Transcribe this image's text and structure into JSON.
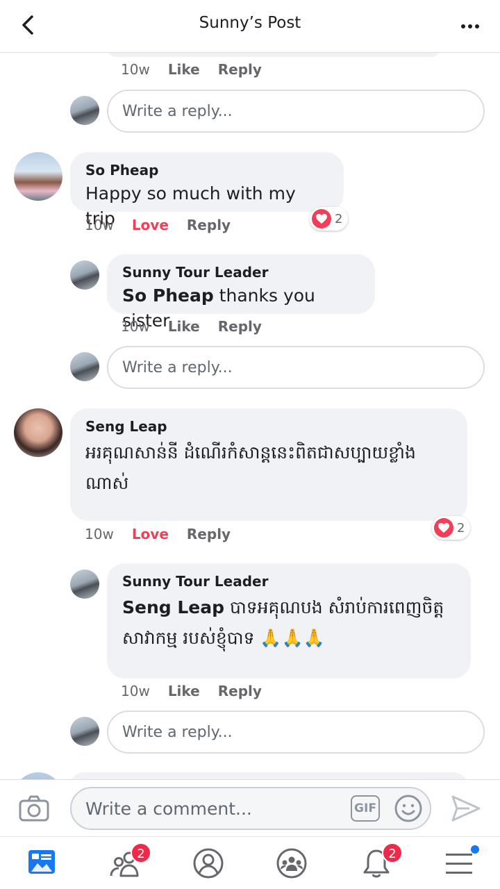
{
  "header": {
    "title": "Sunny’s Post"
  },
  "thread": {
    "top_meta": {
      "time": "10w",
      "like": "Like",
      "reply": "Reply"
    },
    "reply_placeholder": "Write a reply...",
    "comments": [
      {
        "author": "So Pheap",
        "text": "Happy so much with my trip",
        "time": "10w",
        "action": "Love",
        "reply": "Reply",
        "reaction_count": "2",
        "replies": [
          {
            "author": "Sunny Tour Leader",
            "mention": "So Pheap",
            "text": " thanks you sister",
            "time": "10w",
            "like": "Like",
            "reply": "Reply"
          }
        ]
      },
      {
        "author": "Seng Leap",
        "text": "អរគុណសាន់នី ដំណើរកំសាន្តនេះពិតជាសប្បាយខ្លាំងណាស់",
        "time": "10w",
        "action": "Love",
        "reply": "Reply",
        "reaction_count": "2",
        "replies": [
          {
            "author": "Sunny Tour Leader",
            "mention": "Seng Leap",
            "text": " បាទអគុណបង សំរាប់ការពេញចិត្ត សាវាកម្ម របស់ខ្ញុំបាទ 🙏🙏🙏",
            "time": "10w",
            "like": "Like",
            "reply": "Reply"
          }
        ]
      }
    ]
  },
  "composer": {
    "placeholder": "Write a comment...",
    "gif_label": "GIF"
  },
  "nav": {
    "friends_badge": "2",
    "notifications_badge": "2"
  },
  "colors": {
    "love": "#f33e58",
    "badge": "#f02849",
    "accent": "#1877f2"
  }
}
